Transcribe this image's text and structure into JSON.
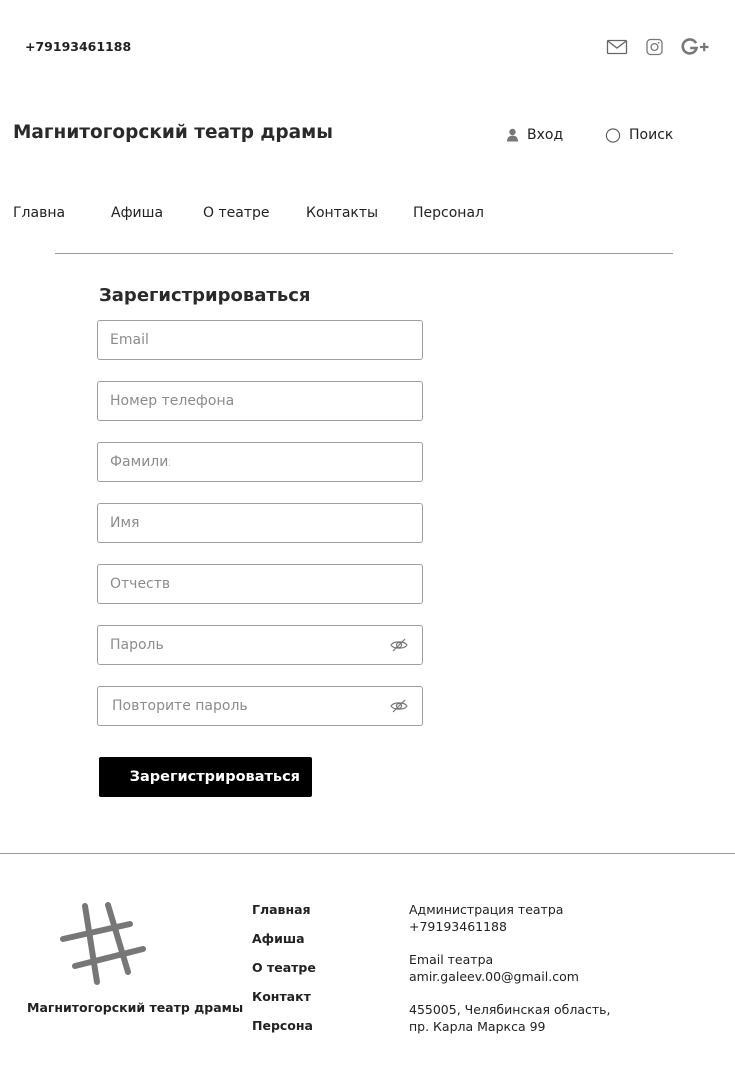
{
  "topbar": {
    "phone": "+79193461188",
    "social": [
      "mail-icon",
      "instagram-icon",
      "google-plus-icon"
    ]
  },
  "header": {
    "site_title": "Магнитогорский театр драмы",
    "login_label": "Вход",
    "search_label": "Поиск"
  },
  "nav": {
    "items": [
      "Главная",
      "Афиша",
      "О театре",
      "Контакты",
      "Персонал"
    ]
  },
  "form": {
    "title": "Зарегистрироваться",
    "fields": {
      "email_placeholder": "Email",
      "phone_placeholder": "Номер телефона",
      "surname_placeholder": "Фамилия",
      "name_placeholder": "Имя",
      "patronymic_placeholder": "Отчество",
      "password_placeholder": "Пароль",
      "password_repeat_placeholder": "Повторите пароль"
    },
    "submit_label": "Зарегистрироваться"
  },
  "footer": {
    "site_name": "Магнитогорский театр драмы",
    "links": [
      "Главная",
      "Афиша",
      "О театре",
      "Контакт",
      "Персона"
    ],
    "admin_label": "Администрация театра",
    "admin_phone": "+79193461188",
    "email_label": "Email театра",
    "email_value": "amir.galeev.00@gmail.com",
    "address_line1": "455005, Челябинская область,",
    "address_line2": "пр. Карла Маркса 99"
  }
}
